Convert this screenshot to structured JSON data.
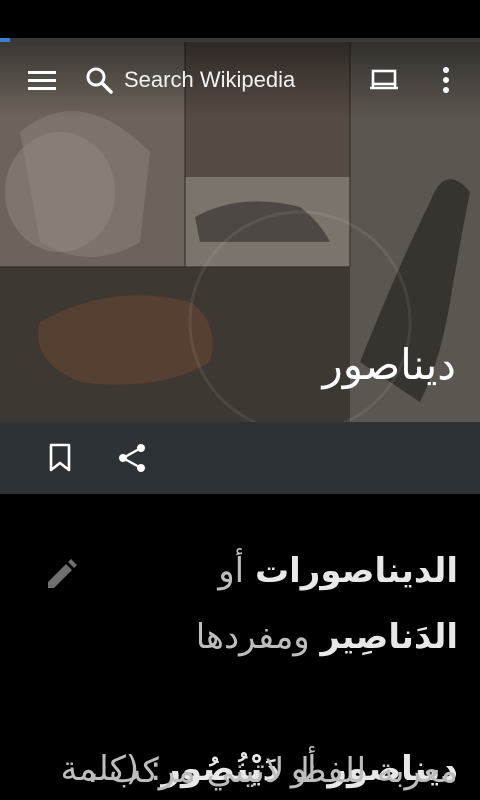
{
  "progress": {
    "value_percent": 2
  },
  "toolbar": {
    "menu_icon": "hamburger-menu-icon",
    "search_icon": "search-icon",
    "search_label": "Search Wikipedia",
    "tabs_icon": "tabs-icon",
    "more_icon": "overflow-menu-icon"
  },
  "article": {
    "title": "ديناصور",
    "lead": {
      "term1": "الديناصورات",
      "or1": " أو ",
      "term2": "الدَناصِير",
      "and_singular": " ومفردها ",
      "term3": "ديناصور",
      "or2": " أو ",
      "term4": "دَيْنُصُور",
      "rest": ": (كلمة",
      "line5": "معربة للفظ لاتيني مركب ،"
    }
  },
  "actions": {
    "bookmark_icon": "bookmark-icon",
    "share_icon": "share-icon",
    "edit_icon": "edit-pencil-icon"
  },
  "colors": {
    "progress": "#3a7fd0",
    "action_bar": "#2c3236",
    "background": "#000000"
  }
}
